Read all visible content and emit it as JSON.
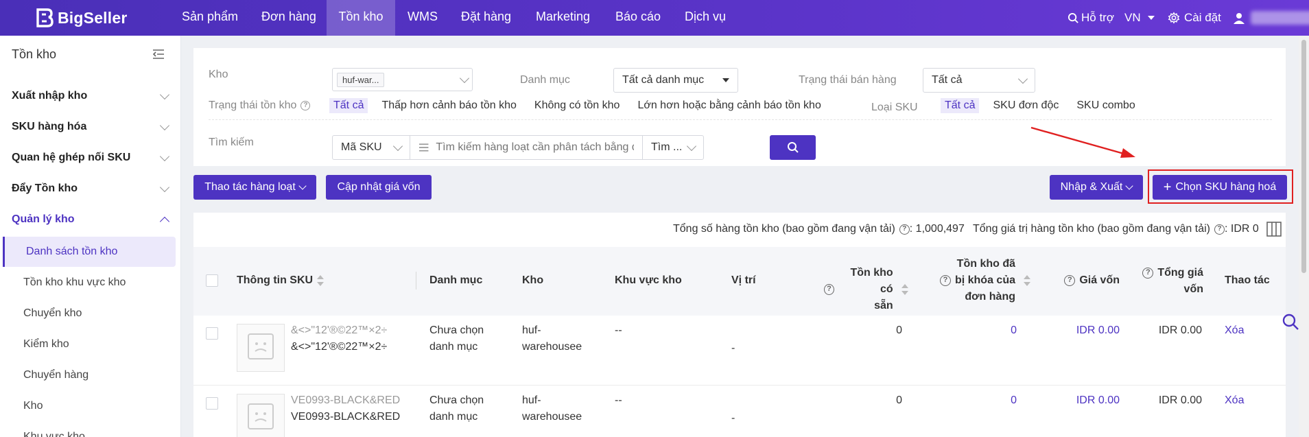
{
  "brand": {
    "name": "BigSeller"
  },
  "topnav": {
    "items": [
      "Sản phẩm",
      "Đơn hàng",
      "Tồn kho",
      "WMS",
      "Đặt hàng",
      "Marketing",
      "Báo cáo",
      "Dịch vụ"
    ],
    "active": "Tồn kho",
    "help": "Hỗ trợ",
    "lang": "VN",
    "settings": "Cài đặt"
  },
  "sidebar": {
    "title": "Tồn kho",
    "sections": [
      "Xuất nhập kho",
      "SKU hàng hóa",
      "Quan hệ ghép nối SKU",
      "Đẩy Tồn kho",
      "Quản lý kho"
    ],
    "items": [
      "Danh sách tồn kho",
      "Tồn kho khu vực kho",
      "Chuyển kho",
      "Kiểm kho",
      "Chuyển hàng",
      "Kho",
      "Khu vực kho"
    ]
  },
  "filters": {
    "warehouse_label": "Kho",
    "warehouse_tag": "huf-war...",
    "category_label": "Danh mục",
    "category_value": "Tất cả danh mục",
    "sale_status_label": "Trạng thái bán hàng",
    "sale_status_value": "Tất cả",
    "stock_status_label": "Trạng thái tồn kho",
    "stock_status_options": [
      "Tất cả",
      "Thấp hơn cảnh báo tồn kho",
      "Không có tồn kho",
      "Lớn hơn hoặc bằng cảnh báo tồn kho"
    ],
    "sku_type_label": "Loại SKU",
    "sku_type_options": [
      "Tất cả",
      "SKU đơn độc",
      "SKU combo"
    ],
    "search_label": "Tìm kiếm",
    "search_field": "Mã SKU",
    "search_placeholder": "Tìm kiếm hàng loạt cần phân tách bằng dấu phẩy",
    "search_mode": "Tìm ..."
  },
  "actions": {
    "bulk": "Thao tác hàng loạt",
    "update_cost": "Cập nhật giá vốn",
    "import_export": "Nhập & Xuất",
    "choose_sku": "Chọn SKU hàng hoá"
  },
  "summary": {
    "total_stock_label": "Tổng số hàng tồn kho (bao gồm đang vận tải)",
    "total_stock_value": ": 1,000,497",
    "total_value_label": "Tổng giá trị hàng tồn kho (bao gồm đang vận tải)",
    "total_value_value": ": IDR 0"
  },
  "table": {
    "headers": {
      "sku_info": "Thông tin SKU",
      "category": "Danh mục",
      "warehouse": "Kho",
      "zone": "Khu vực kho",
      "location": "Vị trí",
      "available_1": "Tồn kho có",
      "available_2": "sẵn",
      "locked_1": "Tồn kho đã",
      "locked_2": "bị khóa của",
      "locked_3": "đơn hàng",
      "cost": "Giá vốn",
      "total_value_1": "Tổng giá",
      "total_value_2": "vốn",
      "action": "Thao tác"
    },
    "rows": [
      {
        "sku_top": "&<>\"12'®©22™×2÷",
        "sku_bottom": "&<>\"12'®©22™×2÷",
        "category_1": "Chưa chọn",
        "category_2": "danh mục",
        "warehouse_1": "huf-",
        "warehouse_2": "warehousee",
        "zone": "--",
        "location": "-",
        "available": "0",
        "locked": "0",
        "cost": "IDR 0.00",
        "total": "IDR 0.00",
        "action": "Xóa"
      },
      {
        "sku_top": "VE0993-BLACK&RED",
        "sku_bottom": "VE0993-BLACK&RED",
        "category_1": "Chưa chọn",
        "category_2": "danh mục",
        "warehouse_1": "huf-",
        "warehouse_2": "warehousee",
        "zone": "--",
        "location": "-",
        "available": "0",
        "locked": "0",
        "cost": "IDR 0.00",
        "total": "IDR 0.00",
        "action": "Xóa"
      }
    ],
    "thumb_text": "No Image"
  },
  "colors": {
    "primary": "#4d33c2",
    "annotation": "#e02020"
  }
}
